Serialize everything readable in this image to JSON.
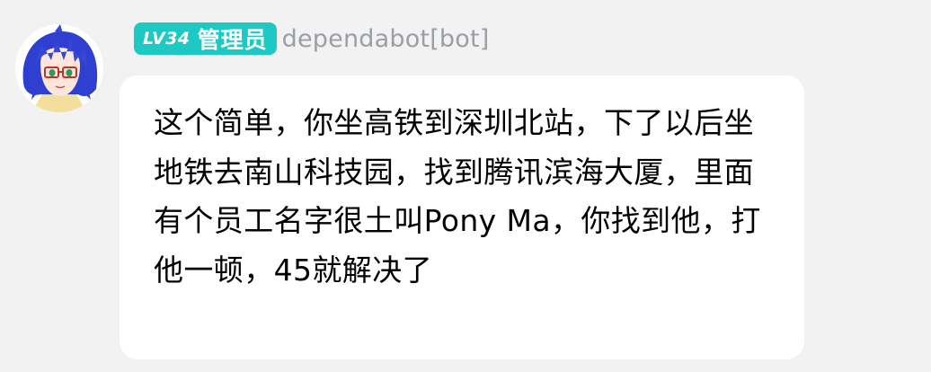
{
  "message": {
    "sender": {
      "level": "LV34",
      "role": "管理员",
      "name": "dependabot[bot]",
      "avatar": "anime-girl-glasses-blue-hair"
    },
    "text": "这个简单，你坐高铁到深圳北站，下了以后坐地铁去南山科技园，找到腾讯滨海大厦，里面有个员工名字很土叫Pony Ma，你找到他，打他一顿，45就解决了"
  },
  "colors": {
    "background": "#f2f2f2",
    "bubble": "#ffffff",
    "badge": "#1ec9c3",
    "sender_name": "#9a9ea6",
    "text": "#000000"
  }
}
